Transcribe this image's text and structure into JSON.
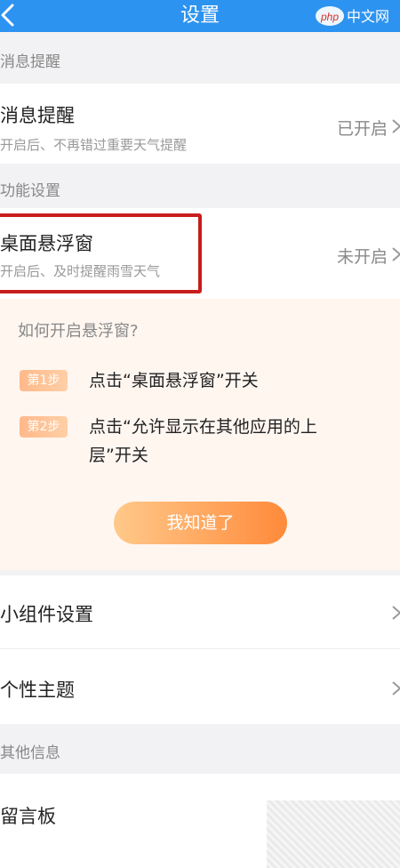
{
  "header": {
    "title": "设置",
    "back_icon": "chevron-left-icon"
  },
  "watermark": {
    "text": "中文网",
    "badge": "php"
  },
  "sections": {
    "notifications": "消息提醒",
    "features": "功能设置",
    "other": "其他信息"
  },
  "rows": {
    "notification": {
      "label": "消息提醒",
      "subtitle": "开启后、不再错过重要天气提醒",
      "value": "已开启"
    },
    "floating_window": {
      "label": "桌面悬浮窗",
      "subtitle": "开启后、及时提醒雨雪天气",
      "value": "未开启"
    },
    "widget": {
      "label": "小组件设置"
    },
    "theme": {
      "label": "个性主题"
    },
    "message_board": {
      "label": "留言板"
    }
  },
  "guide": {
    "question": "如何开启悬浮窗?",
    "step1_badge": "第1步",
    "step1_text": "点击“桌面悬浮窗”开关",
    "step2_badge": "第2步",
    "step2_line1": "点击“允许显示在其他应用的上",
    "step2_line2": "层”开关",
    "button": "我知道了"
  },
  "colors": {
    "header": "#2d93f0",
    "highlight": "#c81e1e",
    "accent": "#ff8a3a"
  }
}
